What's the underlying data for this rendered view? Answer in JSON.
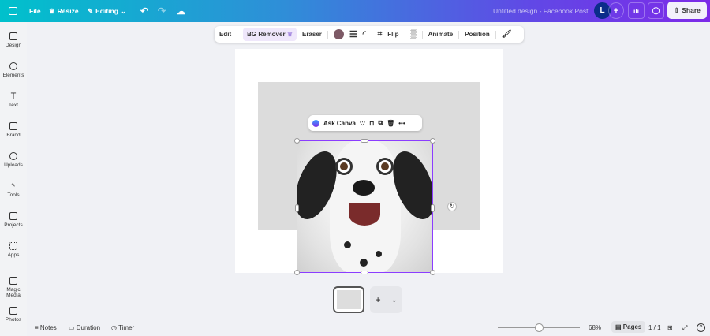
{
  "topbar": {
    "file": "File",
    "resize": "Resize",
    "editing": "Editing",
    "title": "Untitled design - Facebook Post",
    "avatar": "L",
    "share": "Share"
  },
  "sidebar": [
    {
      "label": "Design"
    },
    {
      "label": "Elements"
    },
    {
      "label": "Text"
    },
    {
      "label": "Brand"
    },
    {
      "label": "Uploads"
    },
    {
      "label": "Tools"
    },
    {
      "label": "Projects"
    },
    {
      "label": "Apps"
    },
    {
      "label": "Magic Media"
    },
    {
      "label": "Photos"
    }
  ],
  "toolbar": {
    "edit": "Edit",
    "bg_remover": "BG Remover",
    "eraser": "Eraser",
    "color": "#7d5a66",
    "flip": "Flip",
    "animate": "Animate",
    "position": "Position"
  },
  "context": {
    "ask": "Ask Canva"
  },
  "bottom": {
    "notes": "Notes",
    "duration": "Duration",
    "timer": "Timer",
    "zoom": "68%",
    "zoom_fraction": 0.5,
    "pages": "Pages",
    "page_count": "1 / 1"
  }
}
